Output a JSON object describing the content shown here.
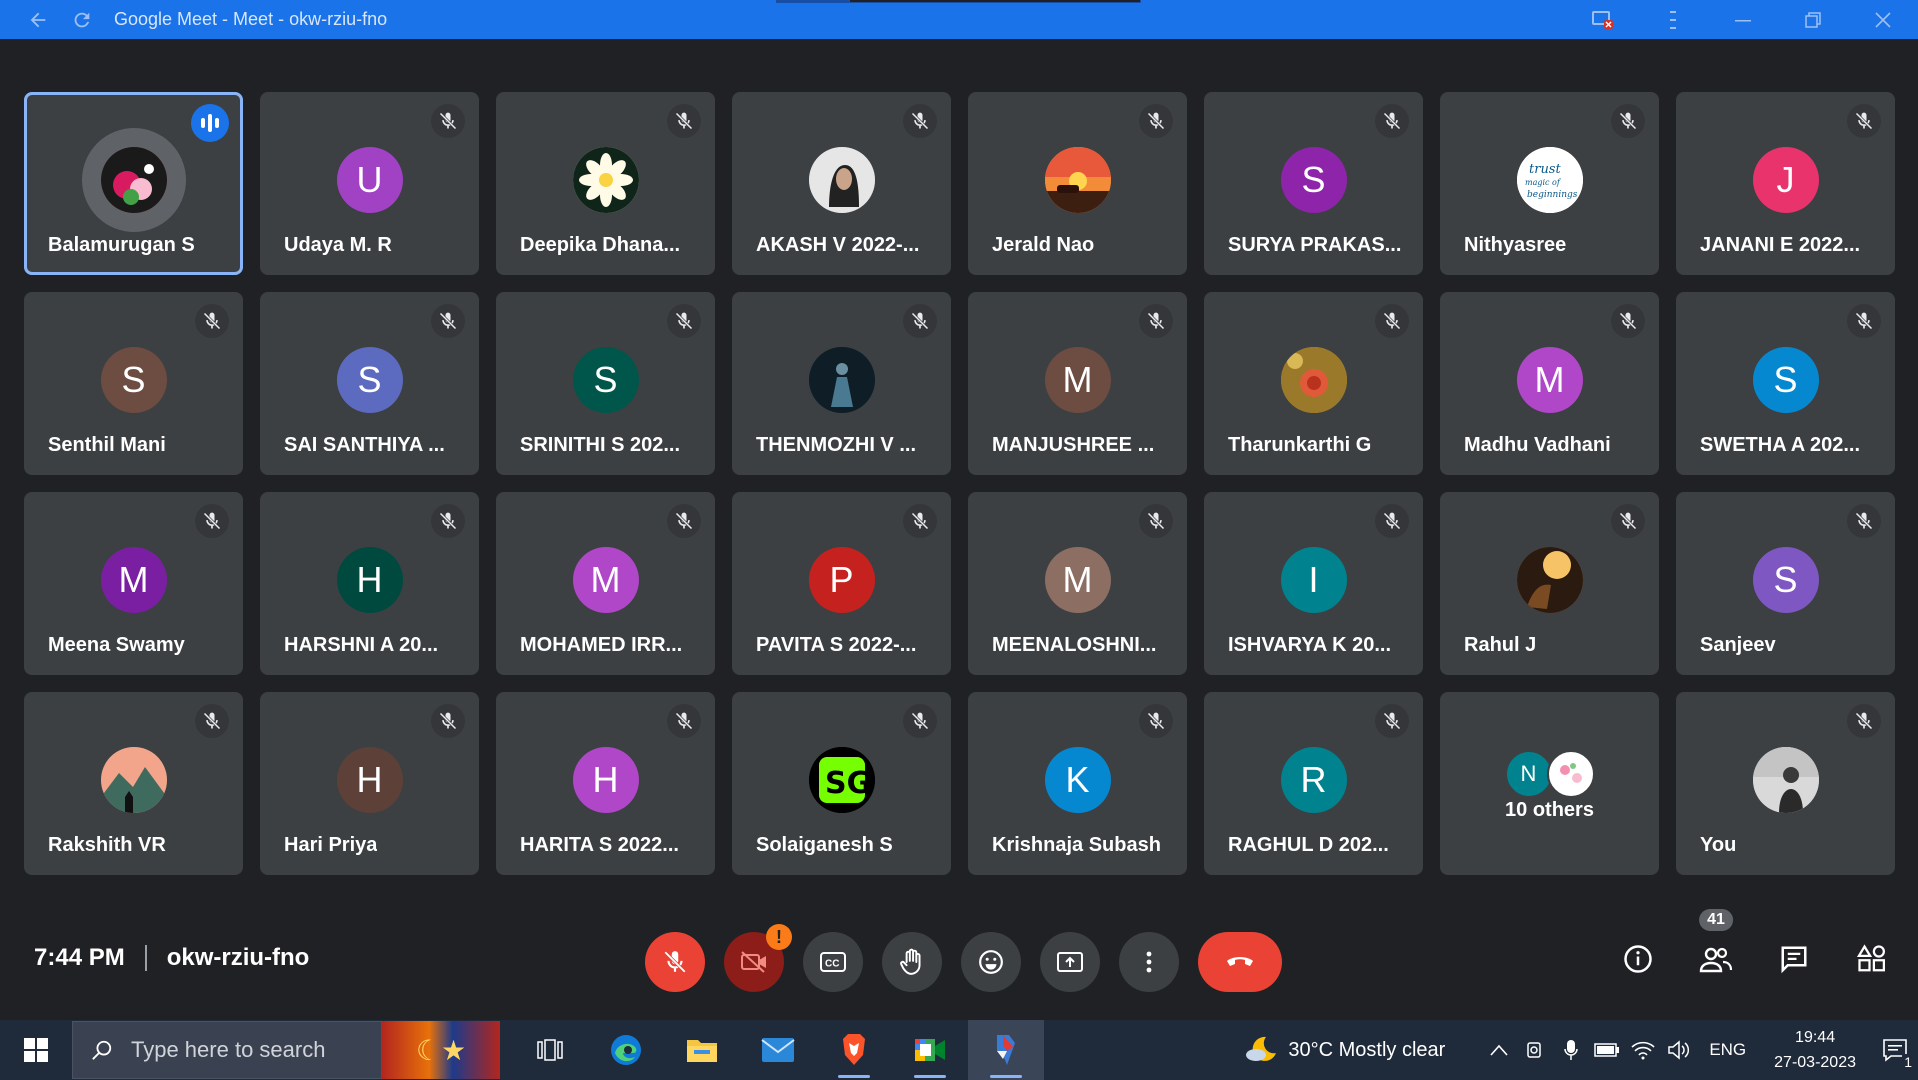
{
  "window": {
    "title": "Google Meet - Meet - okw-rziu-fno"
  },
  "colors": {
    "title_bar": "#1a73e8",
    "stage_bg": "#202124",
    "tile_bg": "#3c4043",
    "speaking_border": "#8ab4f8",
    "leave_red": "#ea4335"
  },
  "participants": [
    {
      "name": "Balamurugan S",
      "initial": "",
      "avatar": "photo-flowers",
      "color": "#b3475b",
      "speaking": true
    },
    {
      "name": "Udaya M. R",
      "initial": "U",
      "color": "#a142c5"
    },
    {
      "name": "Deepika Dhana...",
      "initial": "",
      "avatar": "photo-white-flower",
      "color": "#f5f0d8"
    },
    {
      "name": "AKASH V 2022-...",
      "initial": "",
      "avatar": "photo-portrait",
      "color": "#8a8a8a"
    },
    {
      "name": "Jerald Nao",
      "initial": "",
      "avatar": "photo-sunset",
      "color": "#e8734a"
    },
    {
      "name": "SURYA PRAKAS...",
      "initial": "S",
      "color": "#8e24aa"
    },
    {
      "name": "Nithyasree",
      "initial": "",
      "avatar": "photo-quote",
      "color": "#ffffff"
    },
    {
      "name": "JANANI E 2022...",
      "initial": "J",
      "color": "#e8336d"
    },
    {
      "name": "Senthil Mani",
      "initial": "S",
      "color": "#6d4c41"
    },
    {
      "name": "SAI SANTHIYA ...",
      "initial": "S",
      "color": "#5c6bc0"
    },
    {
      "name": "SRINITHI S 202...",
      "initial": "S",
      "color": "#00564a"
    },
    {
      "name": "THENMOZHI V ...",
      "initial": "",
      "avatar": "photo-dark",
      "color": "#1e3a4a"
    },
    {
      "name": "MANJUSHREE ...",
      "initial": "M",
      "color": "#6d4c41"
    },
    {
      "name": "Tharunkarthi G",
      "initial": "",
      "avatar": "photo-rose",
      "color": "#c7872a"
    },
    {
      "name": "Madhu Vadhani",
      "initial": "M",
      "color": "#b046c8"
    },
    {
      "name": "SWETHA A 202...",
      "initial": "S",
      "color": "#0688d1"
    },
    {
      "name": "Meena Swamy",
      "initial": "M",
      "color": "#7b1fa2"
    },
    {
      "name": "HARSHNI A 20...",
      "initial": "H",
      "color": "#00493e"
    },
    {
      "name": "MOHAMED IRR...",
      "initial": "M",
      "color": "#b046c8"
    },
    {
      "name": "PAVITA S 2022-...",
      "initial": "P",
      "color": "#c5221f"
    },
    {
      "name": "MEENALOSHNI...",
      "initial": "M",
      "color": "#8d6e63"
    },
    {
      "name": "ISHVARYA K 20...",
      "initial": "I",
      "color": "#00838f"
    },
    {
      "name": "Rahul J",
      "initial": "",
      "avatar": "photo-light",
      "color": "#b0743a"
    },
    {
      "name": "Sanjeev",
      "initial": "S",
      "color": "#7e57c2"
    },
    {
      "name": "Rakshith VR",
      "initial": "",
      "avatar": "photo-mountain",
      "color": "#3a6b5a"
    },
    {
      "name": "Hari Priya",
      "initial": "H",
      "color": "#5d4037"
    },
    {
      "name": "HARITA S 2022...",
      "initial": "H",
      "color": "#b046c8"
    },
    {
      "name": "Solaiganesh S",
      "initial": "",
      "avatar": "photo-logo",
      "color": "#111111"
    },
    {
      "name": "Krishnaja Subash",
      "initial": "K",
      "color": "#0688d1"
    },
    {
      "name": "RAGHUL D 202...",
      "initial": "R",
      "color": "#00838f"
    }
  ],
  "others_tile": {
    "label": "10 others",
    "avatar_initial": "N",
    "avatar_color": "#00838f"
  },
  "self_tile": {
    "name": "You",
    "avatar": "photo-self",
    "color": "#9aa0a6"
  },
  "meeting": {
    "time": "7:44 PM",
    "code": "okw-rziu-fno"
  },
  "controls": {
    "participants_count": "41"
  },
  "taskbar": {
    "search_placeholder": "Type here to search",
    "weather": "30°C  Mostly clear",
    "language": "ENG",
    "time": "19:44",
    "date": "27-03-2023",
    "notification_count": "1"
  }
}
